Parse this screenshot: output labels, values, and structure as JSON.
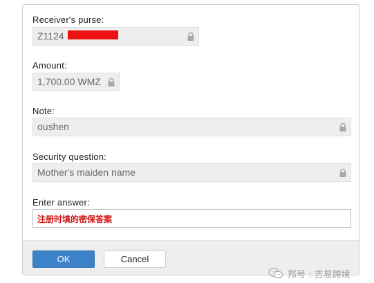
{
  "form": {
    "receiver_label": "Receiver's purse:",
    "receiver_value": "Z1124",
    "amount_label": "Amount:",
    "amount_value": "1,700.00 WMZ",
    "note_label": "Note:",
    "note_value": "oushen",
    "question_label": "Security question:",
    "question_value": "Mother's maiden name",
    "answer_label": "Enter answer:",
    "answer_value": "注册时填的密保答案"
  },
  "buttons": {
    "ok_label": "OK",
    "cancel_label": "Cancel"
  },
  "watermark": {
    "text": "邦号 : 吉易跨境"
  },
  "icons": {
    "lock": "lock-icon",
    "watermark": "wechat-icon"
  },
  "colors": {
    "ok_button": "#3c82c8",
    "answer_text": "#d01010",
    "redaction": "#ee1111"
  }
}
